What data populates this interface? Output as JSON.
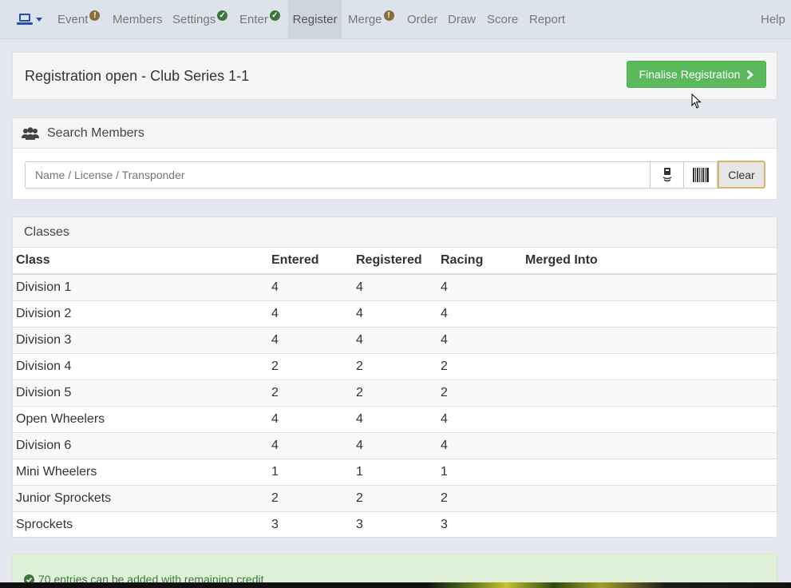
{
  "nav": {
    "brand_icon": "laptop-icon",
    "items": [
      {
        "label": "Event",
        "badge": "warn"
      },
      {
        "label": "Members",
        "badge": ""
      },
      {
        "label": "Settings",
        "badge": "ok"
      },
      {
        "label": "Enter",
        "badge": "ok"
      },
      {
        "label": "Register",
        "badge": "",
        "active": true
      },
      {
        "label": "Merge",
        "badge": "warn"
      },
      {
        "label": "Order",
        "badge": ""
      },
      {
        "label": "Draw",
        "badge": ""
      },
      {
        "label": "Score",
        "badge": ""
      },
      {
        "label": "Report",
        "badge": ""
      }
    ],
    "help": "Help"
  },
  "registration": {
    "title": "Registration open - Club Series 1-1",
    "finalise_label": "Finalise Registration"
  },
  "search": {
    "title": "Search Members",
    "placeholder": "Name / License / Transponder",
    "clear_label": "Clear"
  },
  "classes": {
    "title": "Classes",
    "columns": [
      "Class",
      "Entered",
      "Registered",
      "Racing",
      "Merged Into"
    ],
    "rows": [
      [
        "Division 1",
        "4",
        "4",
        "4",
        ""
      ],
      [
        "Division 2",
        "4",
        "4",
        "4",
        ""
      ],
      [
        "Division 3",
        "4",
        "4",
        "4",
        ""
      ],
      [
        "Division 4",
        "2",
        "2",
        "2",
        ""
      ],
      [
        "Division 5",
        "2",
        "2",
        "2",
        ""
      ],
      [
        "Open Wheelers",
        "4",
        "4",
        "4",
        ""
      ],
      [
        "Division 6",
        "4",
        "4",
        "4",
        ""
      ],
      [
        "Mini Wheelers",
        "1",
        "1",
        "1",
        ""
      ],
      [
        "Junior Sprockets",
        "2",
        "2",
        "2",
        ""
      ],
      [
        "Sprockets",
        "3",
        "3",
        "3",
        ""
      ]
    ]
  },
  "alert": {
    "text": "70 entries can be added with remaining credit"
  },
  "colors": {
    "success": "#5cb85c",
    "nav_bg": "#dde3eb",
    "brand_blue": "#2a4fa8",
    "warn": "#8a6d3b",
    "ok": "#3c763d"
  }
}
